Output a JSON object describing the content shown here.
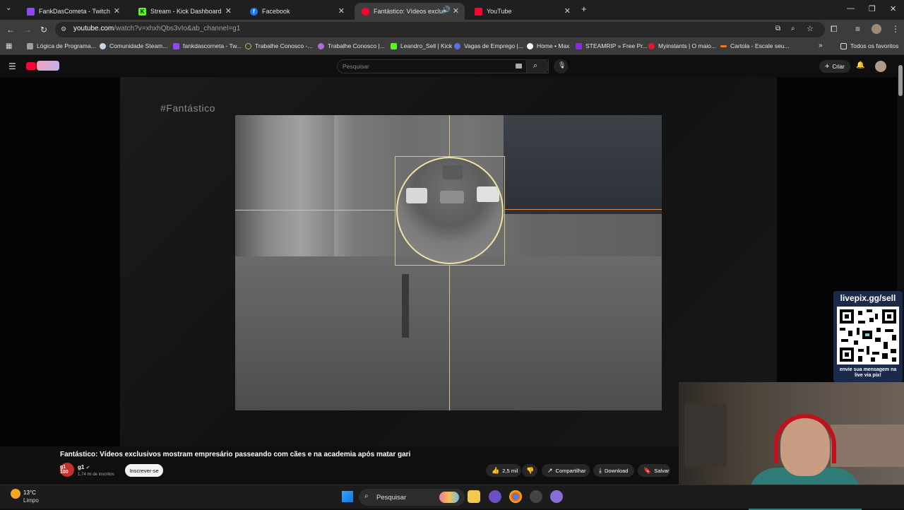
{
  "browser": {
    "tabs": [
      {
        "label": "FankDasCometa - Twitch",
        "color": "#9146ff"
      },
      {
        "label": "Stream - Kick Dashboard",
        "color": "#53fc18"
      },
      {
        "label": "Facebook",
        "color": "#1877f2"
      },
      {
        "label": "Fantástico: Vídeos exclusivo",
        "color": "#ff0033"
      },
      {
        "label": "YouTube",
        "color": "#ff0033"
      }
    ],
    "new_tab": "+",
    "url_main": "youtube.com",
    "url_rest": "/watch?v=xhxhQbs3vIo&ab_channel=g1",
    "bookmarks": [
      {
        "label": "Lógica de Programa...",
        "color": "#9aa0a6"
      },
      {
        "label": "Comunidade Steam...",
        "color": "#c7d5e0"
      },
      {
        "label": "fankdascorneta - Tw...",
        "color": "#9146ff"
      },
      {
        "label": "Trabalhe Conosco -...",
        "color": "#d4b04a"
      },
      {
        "label": "Trabalhe Conosco |...",
        "color": "#b06ad6"
      },
      {
        "label": "Leandro_Sell | Kick",
        "color": "#53fc18"
      },
      {
        "label": "Vagas de Emprego |...",
        "color": "#5a6ee0"
      },
      {
        "label": "Home • Max",
        "color": "#ffffff"
      },
      {
        "label": "STEAMRIP » Free Pr...",
        "color": "#8a2be2"
      },
      {
        "label": "Myinstants | O maio...",
        "color": "#e0192e"
      },
      {
        "label": "Cartola - Escale seu...",
        "color": "#f07820"
      }
    ],
    "all_bookmarks": "Todos os favoritos"
  },
  "youtube": {
    "search_placeholder": "Pesquisar",
    "create_label": "Criar",
    "hashtag": "#Fantástico",
    "video_title": "Fantástico: Vídeos exclusivos mostram empresário passeando com cães e na academia após matar gari",
    "channel_name": "g1",
    "channel_avatar": "g1 100",
    "channel_subs": "1,74 mi de inscritos",
    "subscribe_label": "Inscrever-se",
    "likes": "2,5 mil",
    "share_label": "Compartilhar",
    "download_label": "Download",
    "save_label": "Salvar"
  },
  "overlay": {
    "livepix_url": "livepix.gg/sell",
    "livepix_message": "envie sua mensagem na live via pix!"
  },
  "taskbar": {
    "temperature": "13°C",
    "weather": "Limpo",
    "search_label": "Pesquisar"
  }
}
